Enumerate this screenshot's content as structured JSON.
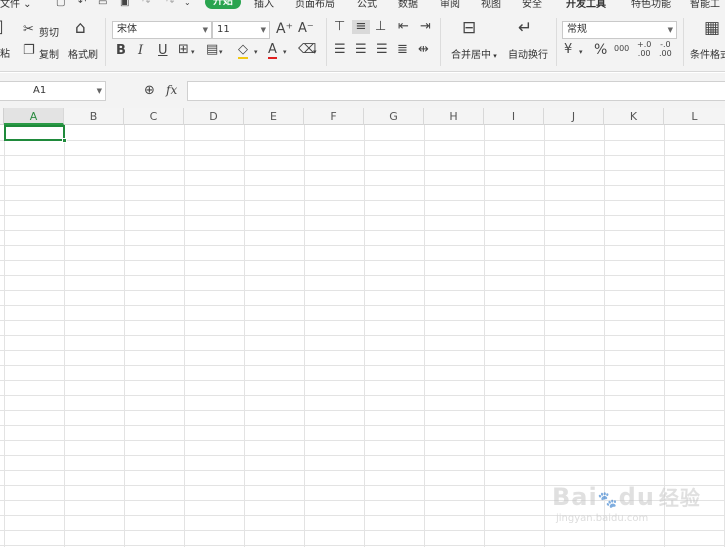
{
  "menu": {
    "file": "文件",
    "tabs": [
      "开始",
      "插入",
      "页面布局",
      "公式",
      "数据",
      "审阅",
      "视图",
      "安全",
      "开发工具",
      "特色功能",
      "智能工"
    ]
  },
  "ribbon": {
    "paste_label": "粘",
    "cut_label": "剪切",
    "copy_label": "复制",
    "format_painter_label": "格式刷",
    "font_name": "宋体",
    "font_size": "11",
    "bold": "B",
    "italic": "I",
    "underline": "U",
    "font_color_glyph": "A",
    "merge_center_label": "合并居中",
    "wrap_text_label": "自动换行",
    "number_format": "常规",
    "percent_glyph": "%",
    "thousands_glyph": "000",
    "inc_decimal_glyph": "+.0\n.00",
    "dec_decimal_glyph": "-.0\n.00",
    "conditional_format_label": "条件格式"
  },
  "formula_bar": {
    "name_box": "A1",
    "fx_label": "fx",
    "formula": ""
  },
  "sheet": {
    "columns": [
      "A",
      "B",
      "C",
      "D",
      "E",
      "F",
      "G",
      "H",
      "I",
      "J",
      "K",
      "L"
    ],
    "selected_cell": "A1",
    "selected_column": "A",
    "accent_color": "#1f8a3b"
  },
  "watermark": {
    "brand": "Bai",
    "brand2": "du",
    "jingyan": "经验",
    "url": "jingyan.baidu.com"
  }
}
